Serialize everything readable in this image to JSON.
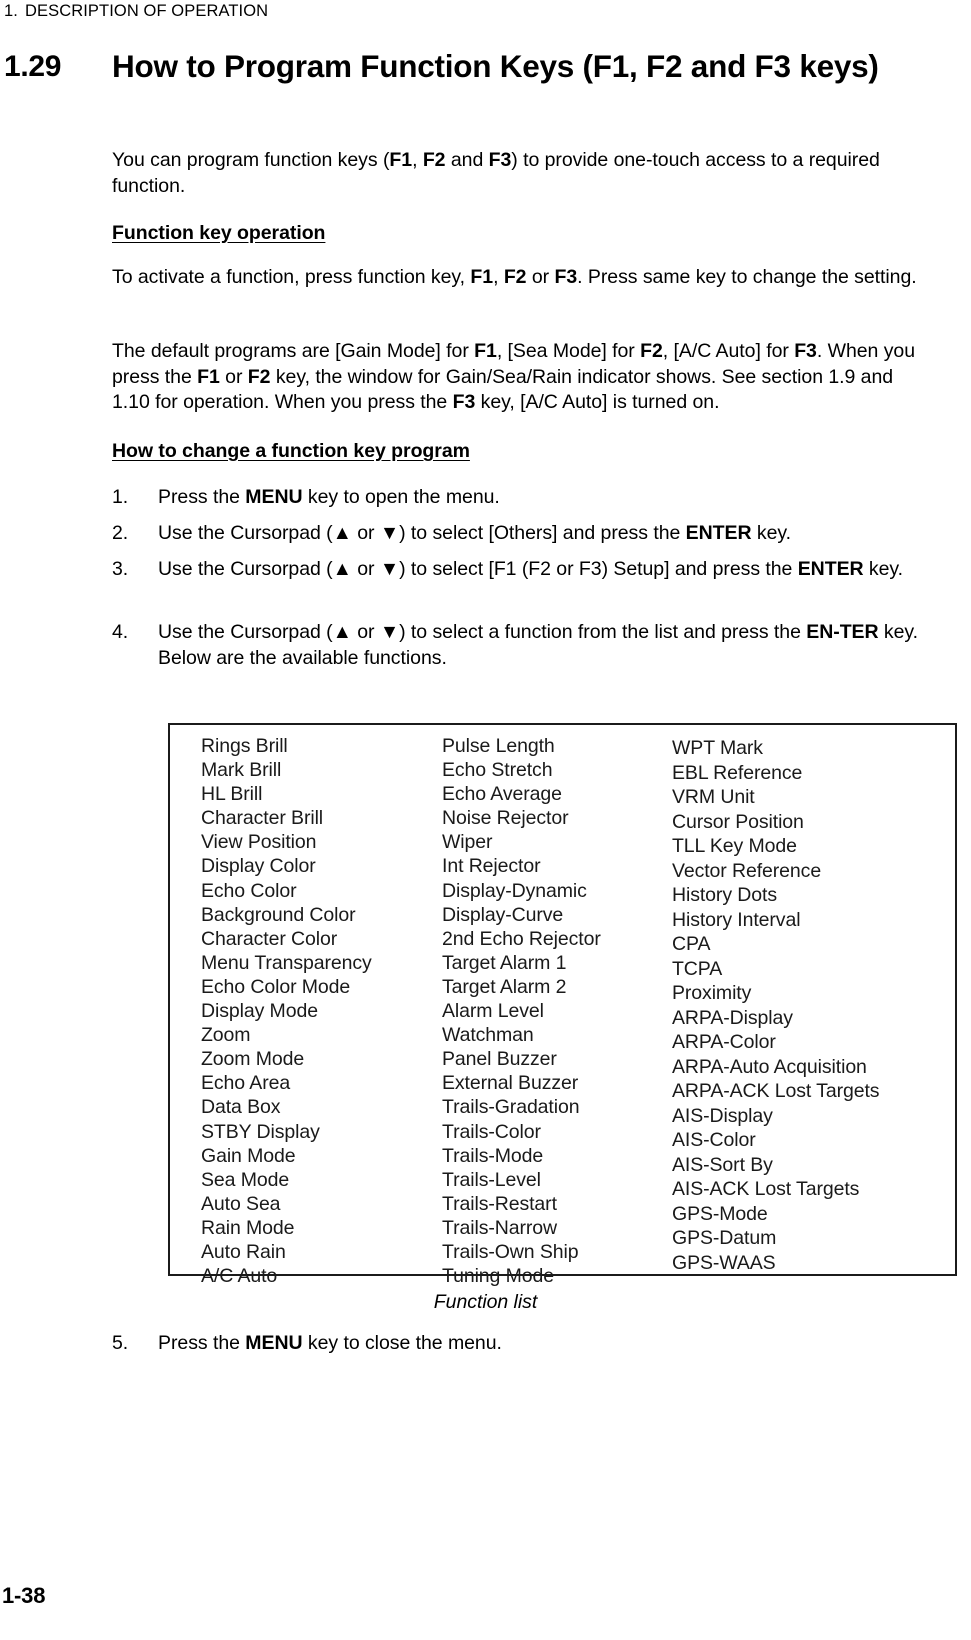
{
  "running_head": {
    "number": "1.",
    "title": "DESCRIPTION OF OPERATION"
  },
  "section": {
    "number": "1.29",
    "title": "How to Program Function Keys (F1, F2 and F3 keys)"
  },
  "intro": {
    "text_1": "You can program function keys (",
    "key_f1": "F1",
    "text_2": ", ",
    "key_f2": "F2",
    "text_3": " and ",
    "key_f3": "F3",
    "text_4": ") to provide one-touch access to a required function."
  },
  "subhead_1": "Function key operation",
  "para_activate": {
    "t1": "To activate a function, press function key, ",
    "k1": "F1",
    "t2": ", ",
    "k2": "F2",
    "t3": " or ",
    "k3": "F3",
    "t4": ". Press same key to change the setting."
  },
  "para_default": {
    "t1": "The default programs are [Gain Mode] for ",
    "k1": "F1",
    "t2": ", [Sea Mode] for ",
    "k2": "F2",
    "t3": ", [A/C Auto] for ",
    "k3": "F3",
    "t4": ". When you press the ",
    "k4": "F1",
    "t5": " or ",
    "k5": "F2",
    "t6": " key, the window for Gain/Sea/Rain indicator shows. See section 1.9 and 1.10 for operation. When you press the ",
    "k6": "F3",
    "t7": " key, [A/C Auto] is turned on."
  },
  "subhead_2": "How to change a function key program",
  "steps": [
    {
      "num": "1.",
      "t1": "Press the ",
      "k1": "MENU",
      "t2": " key to open the menu.",
      "k2": "",
      "t3": ""
    },
    {
      "num": "2.",
      "t1": "Use the Cursorpad (▲ or ▼) to select [Others] and press the ",
      "k1": "ENTER",
      "t2": " key.",
      "k2": "",
      "t3": ""
    },
    {
      "num": "3.",
      "t1": "Use the Cursorpad (▲ or ▼) to select [F1 (F2 or F3) Setup] and press the ",
      "k1": "ENTER",
      "t2": " key.",
      "k2": "",
      "t3": ""
    },
    {
      "num": "4.",
      "t1": "Use the Cursorpad (▲ or ▼) to select a function from the list and press the ",
      "k1": "EN-TER",
      "t2": " key. Below are the available functions.",
      "k2": "",
      "t3": ""
    },
    {
      "num": "5.",
      "t1": "Press the ",
      "k1": "MENU",
      "t2": " key to close the menu.",
      "k2": "",
      "t3": ""
    }
  ],
  "function_list": {
    "caption": "Function list",
    "columns": [
      [
        "Rings Brill",
        "Mark Brill",
        "HL Brill",
        "Character Brill",
        "View Position",
        "Display Color",
        "Echo Color",
        "Background Color",
        "Character Color",
        "Menu Transparency",
        "Echo Color Mode",
        "Display Mode",
        "Zoom",
        "Zoom Mode",
        "Echo Area",
        "Data Box",
        "STBY Display",
        "Gain Mode",
        "Sea Mode",
        "Auto Sea",
        "Rain Mode",
        "Auto Rain",
        "A/C Auto"
      ],
      [
        "Pulse Length",
        "Echo Stretch",
        "Echo Average",
        "Noise Rejector",
        "Wiper",
        "Int Rejector",
        "Display-Dynamic",
        "Display-Curve",
        "2nd Echo Rejector",
        "Target Alarm 1",
        "Target Alarm 2",
        "Alarm Level",
        "Watchman",
        "Panel Buzzer",
        "External Buzzer",
        "Trails-Gradation",
        "Trails-Color",
        "Trails-Mode",
        "Trails-Level",
        "Trails-Restart",
        "Trails-Narrow",
        "Trails-Own Ship",
        "Tuning Mode"
      ],
      [
        "WPT Mark",
        "EBL Reference",
        "VRM Unit",
        "Cursor Position",
        "TLL Key Mode",
        "Vector Reference",
        "History Dots",
        "History Interval",
        "CPA",
        "TCPA",
        "Proximity",
        "ARPA-Display",
        "ARPA-Color",
        "ARPA-Auto Acquisition",
        "ARPA-ACK Lost Targets",
        "AIS-Display",
        "AIS-Color",
        "AIS-Sort By",
        "AIS-ACK Lost Targets",
        "GPS-Mode",
        "GPS-Datum",
        "GPS-WAAS"
      ]
    ]
  },
  "footer": {
    "page_number": "1-38"
  }
}
